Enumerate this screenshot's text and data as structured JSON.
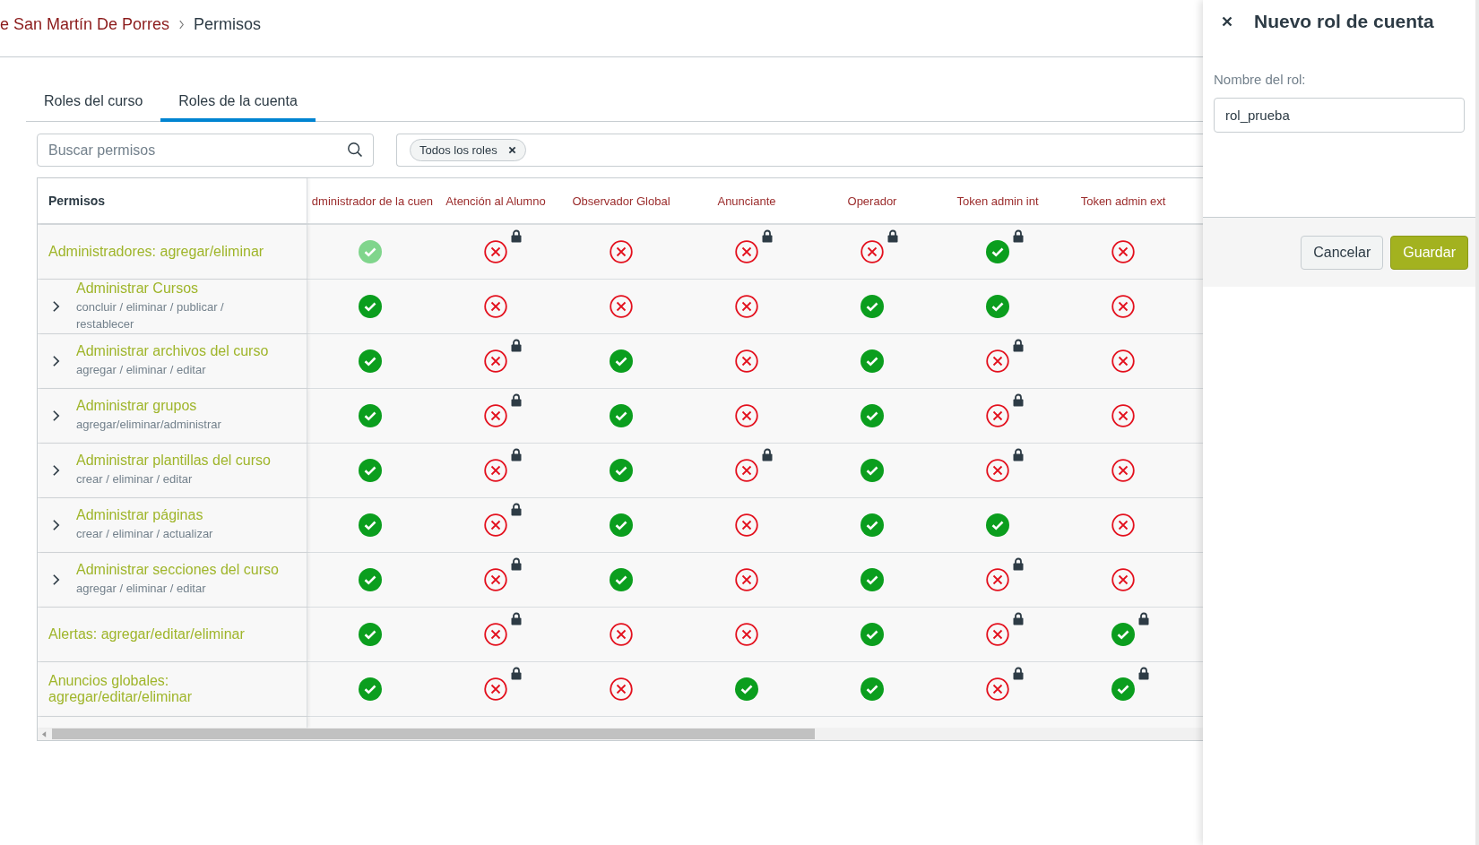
{
  "breadcrumb": {
    "items": [
      {
        "label": "e San Martín De Porres",
        "current": false
      },
      {
        "label": "Permisos",
        "current": true
      }
    ]
  },
  "tabs": [
    {
      "label": "Roles del curso",
      "selected": false
    },
    {
      "label": "Roles de la cuenta",
      "selected": true
    }
  ],
  "search": {
    "placeholder": "Buscar permisos"
  },
  "filter": {
    "tags": [
      "Todos los roles"
    ]
  },
  "table": {
    "columns": [
      "Permisos",
      "dministrador de la cuen",
      "Atención al Alumno",
      "Observador Global",
      "Anunciante",
      "Operador",
      "Token admin int",
      "Token admin ext"
    ],
    "rows": [
      {
        "kind": "single",
        "name": "Administradores: agregar/eliminar",
        "cells": [
          {
            "on": true,
            "locked": false,
            "disabled": true
          },
          {
            "on": false,
            "locked": true,
            "disabled": false
          },
          {
            "on": false,
            "locked": false,
            "disabled": false
          },
          {
            "on": false,
            "locked": true,
            "disabled": false
          },
          {
            "on": false,
            "locked": true,
            "disabled": false
          },
          {
            "on": true,
            "locked": true,
            "disabled": false
          },
          {
            "on": false,
            "locked": false,
            "disabled": false
          }
        ]
      },
      {
        "kind": "group",
        "expanded": false,
        "name": "Administrar Cursos",
        "description": "concluir / eliminar / publicar / restablecer",
        "cells": [
          {
            "on": true,
            "locked": false,
            "disabled": false
          },
          {
            "on": false,
            "locked": false,
            "disabled": false
          },
          {
            "on": false,
            "locked": false,
            "disabled": false
          },
          {
            "on": false,
            "locked": false,
            "disabled": false
          },
          {
            "on": true,
            "locked": false,
            "disabled": false
          },
          {
            "on": true,
            "locked": false,
            "disabled": false
          },
          {
            "on": false,
            "locked": false,
            "disabled": false
          }
        ]
      },
      {
        "kind": "group",
        "expanded": false,
        "name": "Administrar archivos del curso",
        "description": "agregar / eliminar / editar",
        "cells": [
          {
            "on": true,
            "locked": false,
            "disabled": false
          },
          {
            "on": false,
            "locked": true,
            "disabled": false
          },
          {
            "on": true,
            "locked": false,
            "disabled": false
          },
          {
            "on": false,
            "locked": false,
            "disabled": false
          },
          {
            "on": true,
            "locked": false,
            "disabled": false
          },
          {
            "on": false,
            "locked": true,
            "disabled": false
          },
          {
            "on": false,
            "locked": false,
            "disabled": false
          }
        ]
      },
      {
        "kind": "group",
        "expanded": false,
        "name": "Administrar grupos",
        "description": "agregar/eliminar/administrar",
        "cells": [
          {
            "on": true,
            "locked": false,
            "disabled": false
          },
          {
            "on": false,
            "locked": true,
            "disabled": false
          },
          {
            "on": true,
            "locked": false,
            "disabled": false
          },
          {
            "on": false,
            "locked": false,
            "disabled": false
          },
          {
            "on": true,
            "locked": false,
            "disabled": false
          },
          {
            "on": false,
            "locked": true,
            "disabled": false
          },
          {
            "on": false,
            "locked": false,
            "disabled": false
          }
        ]
      },
      {
        "kind": "group",
        "expanded": false,
        "name": "Administrar plantillas del curso",
        "description": "crear / eliminar / editar",
        "cells": [
          {
            "on": true,
            "locked": false,
            "disabled": false
          },
          {
            "on": false,
            "locked": true,
            "disabled": false
          },
          {
            "on": true,
            "locked": false,
            "disabled": false
          },
          {
            "on": false,
            "locked": true,
            "disabled": false
          },
          {
            "on": true,
            "locked": false,
            "disabled": false
          },
          {
            "on": false,
            "locked": true,
            "disabled": false
          },
          {
            "on": false,
            "locked": false,
            "disabled": false
          }
        ]
      },
      {
        "kind": "group",
        "expanded": false,
        "name": "Administrar páginas",
        "description": "crear / eliminar / actualizar",
        "cells": [
          {
            "on": true,
            "locked": false,
            "disabled": false
          },
          {
            "on": false,
            "locked": true,
            "disabled": false
          },
          {
            "on": true,
            "locked": false,
            "disabled": false
          },
          {
            "on": false,
            "locked": false,
            "disabled": false
          },
          {
            "on": true,
            "locked": false,
            "disabled": false
          },
          {
            "on": true,
            "locked": false,
            "disabled": false
          },
          {
            "on": false,
            "locked": false,
            "disabled": false
          }
        ]
      },
      {
        "kind": "group",
        "expanded": false,
        "name": "Administrar secciones del curso",
        "description": "agregar / eliminar / editar",
        "cells": [
          {
            "on": true,
            "locked": false,
            "disabled": false
          },
          {
            "on": false,
            "locked": true,
            "disabled": false
          },
          {
            "on": true,
            "locked": false,
            "disabled": false
          },
          {
            "on": false,
            "locked": false,
            "disabled": false
          },
          {
            "on": true,
            "locked": false,
            "disabled": false
          },
          {
            "on": false,
            "locked": true,
            "disabled": false
          },
          {
            "on": false,
            "locked": false,
            "disabled": false
          }
        ]
      },
      {
        "kind": "single",
        "name": "Alertas: agregar/editar/eliminar",
        "cells": [
          {
            "on": true,
            "locked": false,
            "disabled": false
          },
          {
            "on": false,
            "locked": true,
            "disabled": false
          },
          {
            "on": false,
            "locked": false,
            "disabled": false
          },
          {
            "on": false,
            "locked": false,
            "disabled": false
          },
          {
            "on": true,
            "locked": false,
            "disabled": false
          },
          {
            "on": false,
            "locked": true,
            "disabled": false
          },
          {
            "on": true,
            "locked": true,
            "disabled": false
          }
        ]
      },
      {
        "kind": "single",
        "name": "Anuncios globales: agregar/editar/eliminar",
        "cells": [
          {
            "on": true,
            "locked": false,
            "disabled": false
          },
          {
            "on": false,
            "locked": true,
            "disabled": false
          },
          {
            "on": false,
            "locked": false,
            "disabled": false
          },
          {
            "on": true,
            "locked": false,
            "disabled": false
          },
          {
            "on": true,
            "locked": false,
            "disabled": false
          },
          {
            "on": false,
            "locked": true,
            "disabled": false
          },
          {
            "on": true,
            "locked": true,
            "disabled": false
          }
        ]
      }
    ]
  },
  "panel": {
    "title": "Nuevo rol de cuenta",
    "field": {
      "label": "Nombre del rol:",
      "value": "rol_prueba"
    },
    "buttons": [
      {
        "label": "Cancelar",
        "kind": "secondary"
      },
      {
        "label": "Guardar",
        "kind": "primary"
      }
    ]
  }
}
